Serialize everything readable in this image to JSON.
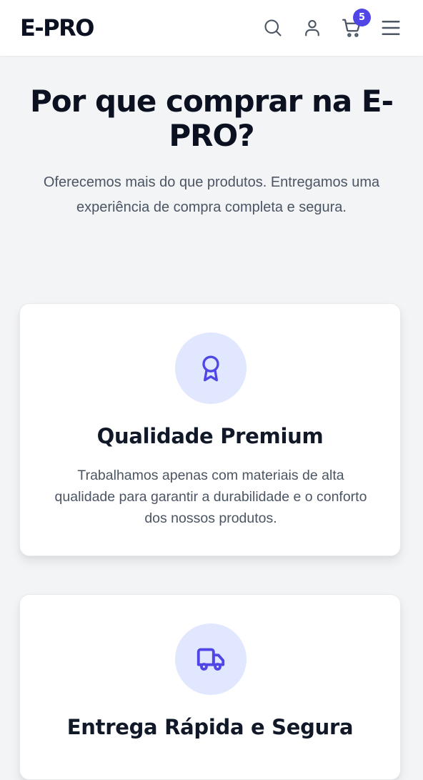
{
  "header": {
    "logo": "E-PRO",
    "cart_count": "5",
    "icons": [
      "search-icon",
      "user-icon",
      "cart-icon",
      "menu-icon"
    ]
  },
  "hero": {
    "title": "Por que comprar na E-PRO?",
    "subtitle": "Oferecemos mais do que produtos. Entregamos uma experiência de compra completa e segura."
  },
  "features": [
    {
      "icon": "award-icon",
      "title": "Qualidade Premium",
      "description": "Trabalhamos apenas com materiais de alta qualidade para garantir a durabilidade e o conforto dos nossos produtos."
    },
    {
      "icon": "truck-icon",
      "title": "Entrega Rápida e Segura",
      "description": ""
    }
  ],
  "colors": {
    "accent": "#4f46e5",
    "icon_bg": "#e0e7ff",
    "page_bg": "#f3f4f6",
    "heading": "#0b1120",
    "body_text": "#4b5563"
  }
}
